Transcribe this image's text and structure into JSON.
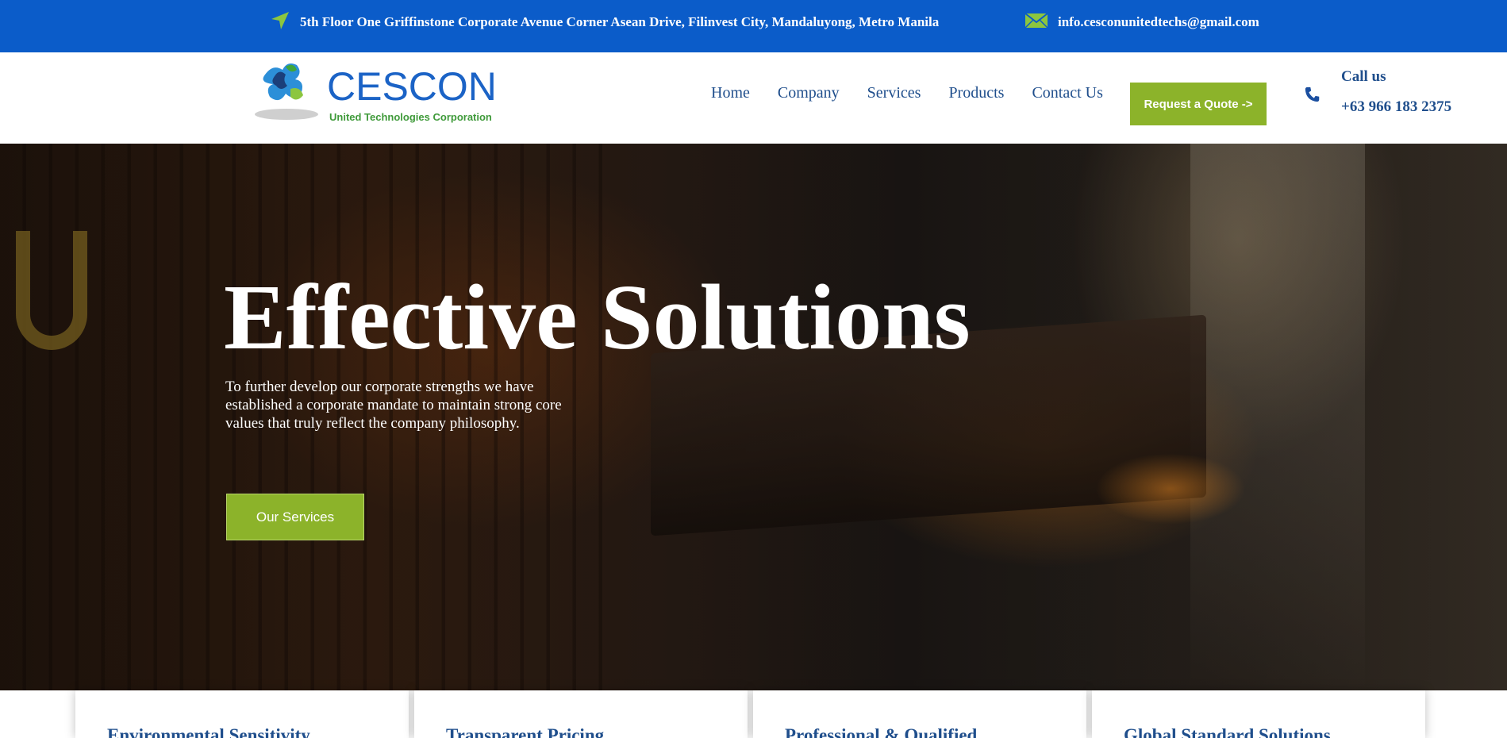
{
  "topbar": {
    "address": "5th Floor One Griffinstone Corporate Avenue Corner Asean Drive, Filinvest City, Mandaluyong, Metro Manila",
    "address_icon": "location-arrow-icon",
    "email": "info.cesconunitedtechs@gmail.com",
    "email_icon": "envelope-icon"
  },
  "header": {
    "logo_name": "CESCON",
    "logo_sub": "United Technologies Corporation",
    "nav": [
      "Home",
      "Company",
      "Services",
      "Products",
      "Contact Us"
    ],
    "quote_button": "Request a Quote ->",
    "phone_icon": "phone-icon",
    "call_label": "Call us",
    "phone_number": "+63 966 183 2375"
  },
  "hero": {
    "title": "Effective Solutions",
    "text": "To further develop our corporate strengths we have established a corporate mandate to maintain strong core values that truly reflect the company philosophy.",
    "button": "Our Services"
  },
  "features": [
    {
      "title": "Environmental Sensitivity"
    },
    {
      "title": "Transparent Pricing"
    },
    {
      "title": "Professional & Qualified"
    },
    {
      "title": "Global Standard Solutions"
    }
  ],
  "colors": {
    "topbar": "#0b5cc9",
    "accent_green": "#8cb32a",
    "nav_text": "#1f4e8c",
    "logo_blue": "#1b63c6"
  }
}
